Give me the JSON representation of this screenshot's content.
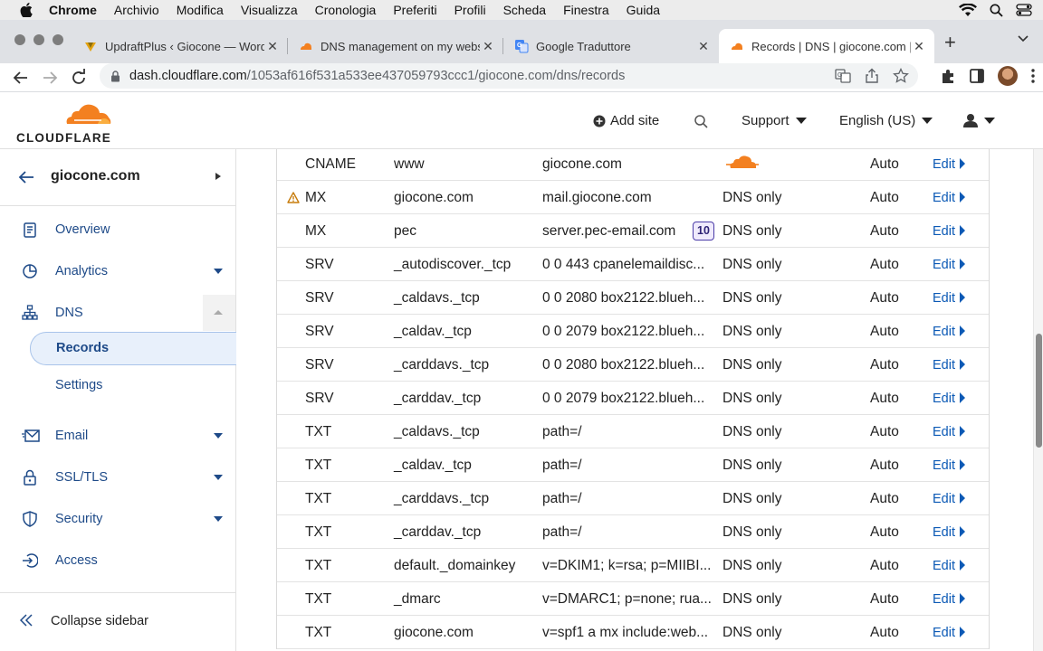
{
  "menubar": {
    "items": [
      "Chrome",
      "Archivio",
      "Modifica",
      "Visualizza",
      "Cronologia",
      "Preferiti",
      "Profili",
      "Scheda",
      "Finestra",
      "Guida"
    ]
  },
  "tabs": [
    {
      "title": "UpdraftPlus ‹ Giocone — Word",
      "icon": "updraftplus-icon"
    },
    {
      "title": "DNS management on my webs",
      "icon": "cloudflare-icon"
    },
    {
      "title": "Google Traduttore",
      "icon": "google-translate-icon"
    },
    {
      "title": "Records | DNS | giocone.com | ",
      "icon": "cloudflare-icon"
    }
  ],
  "address": {
    "domain": "dash.cloudflare.com",
    "path": "/1053af616f531a533ee437059793ccc1/giocone.com/dns/records"
  },
  "header": {
    "logo_text": "CLOUDFLARE",
    "add_site": "Add site",
    "support": "Support",
    "language": "English (US)"
  },
  "sidebar": {
    "zone": "giocone.com",
    "items": {
      "overview": "Overview",
      "analytics": "Analytics",
      "dns": "DNS",
      "records": "Records",
      "settings": "Settings",
      "email": "Email",
      "ssl": "SSL/TLS",
      "security": "Security",
      "access": "Access"
    },
    "collapse": "Collapse sidebar"
  },
  "records": [
    {
      "type": "CNAME",
      "name": "www",
      "content": "giocone.com",
      "proxy": "Proxied",
      "ttl": "Auto",
      "edit": "Edit"
    },
    {
      "type": "MX",
      "name": "giocone.com",
      "content": "mail.giocone.com",
      "proxy": "DNS only",
      "ttl": "Auto",
      "edit": "Edit"
    },
    {
      "type": "MX",
      "name": "pec",
      "content": "server.pec-email.com",
      "priority": "10",
      "proxy": "DNS only",
      "ttl": "Auto",
      "edit": "Edit"
    },
    {
      "type": "SRV",
      "name": "_autodiscover._tcp",
      "content": "0 0 443 cpanelemaildisc...",
      "proxy": "DNS only",
      "ttl": "Auto",
      "edit": "Edit"
    },
    {
      "type": "SRV",
      "name": "_caldavs._tcp",
      "content": "0 0 2080 box2122.blueh...",
      "proxy": "DNS only",
      "ttl": "Auto",
      "edit": "Edit"
    },
    {
      "type": "SRV",
      "name": "_caldav._tcp",
      "content": "0 0 2079 box2122.blueh...",
      "proxy": "DNS only",
      "ttl": "Auto",
      "edit": "Edit"
    },
    {
      "type": "SRV",
      "name": "_carddavs._tcp",
      "content": "0 0 2080 box2122.blueh...",
      "proxy": "DNS only",
      "ttl": "Auto",
      "edit": "Edit"
    },
    {
      "type": "SRV",
      "name": "_carddav._tcp",
      "content": "0 0 2079 box2122.blueh...",
      "proxy": "DNS only",
      "ttl": "Auto",
      "edit": "Edit"
    },
    {
      "type": "TXT",
      "name": "_caldavs._tcp",
      "content": "path=/",
      "proxy": "DNS only",
      "ttl": "Auto",
      "edit": "Edit"
    },
    {
      "type": "TXT",
      "name": "_caldav._tcp",
      "content": "path=/",
      "proxy": "DNS only",
      "ttl": "Auto",
      "edit": "Edit"
    },
    {
      "type": "TXT",
      "name": "_carddavs._tcp",
      "content": "path=/",
      "proxy": "DNS only",
      "ttl": "Auto",
      "edit": "Edit"
    },
    {
      "type": "TXT",
      "name": "_carddav._tcp",
      "content": "path=/",
      "proxy": "DNS only",
      "ttl": "Auto",
      "edit": "Edit"
    },
    {
      "type": "TXT",
      "name": "default._domainkey",
      "content": "v=DKIM1; k=rsa; p=MIIBI...",
      "proxy": "DNS only",
      "ttl": "Auto",
      "edit": "Edit"
    },
    {
      "type": "TXT",
      "name": "_dmarc",
      "content": "v=DMARC1; p=none; rua...",
      "proxy": "DNS only",
      "ttl": "Auto",
      "edit": "Edit"
    },
    {
      "type": "TXT",
      "name": "giocone.com",
      "content": "v=spf1 a mx include:web...",
      "proxy": "DNS only",
      "ttl": "Auto",
      "edit": "Edit"
    }
  ],
  "colors": {
    "cloudflare_orange": "#f38020",
    "link_blue": "#0b59b5",
    "nav_blue": "#1e4a88"
  }
}
